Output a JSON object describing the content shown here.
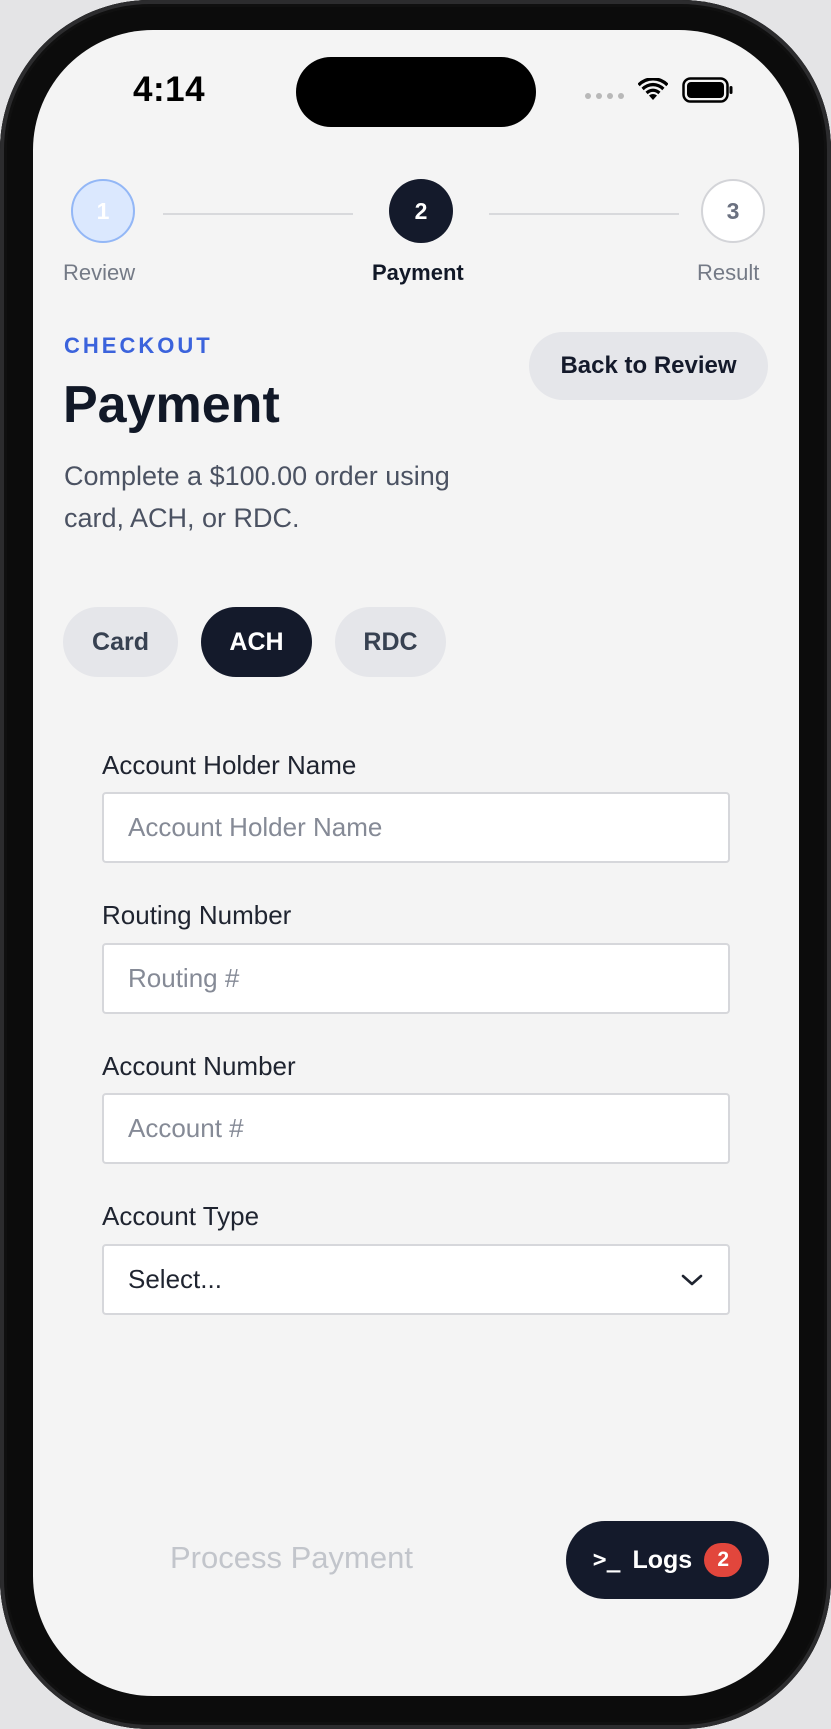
{
  "status_bar": {
    "time": "4:14"
  },
  "stepper": {
    "steps": [
      {
        "number": "1",
        "label": "Review"
      },
      {
        "number": "2",
        "label": "Payment"
      },
      {
        "number": "3",
        "label": "Result"
      }
    ],
    "active_step": 2
  },
  "header": {
    "kicker": "CHECKOUT",
    "title": "Payment",
    "description": "Complete a $100.00 order using card, ACH, or RDC.",
    "back_label": "Back to Review"
  },
  "payment_methods": {
    "options": [
      "Card",
      "ACH",
      "RDC"
    ],
    "selected": "ACH"
  },
  "ach_form": {
    "holder_label": "Account Holder Name",
    "holder_placeholder": "Account Holder Name",
    "routing_label": "Routing Number",
    "routing_placeholder": "Routing #",
    "account_label": "Account Number",
    "account_placeholder": "Account #",
    "type_label": "Account Type",
    "type_value": "Select..."
  },
  "footer": {
    "process_label": "Process Payment",
    "logs_prompt": ">_",
    "logs_label": "Logs",
    "logs_count": "2"
  },
  "colors": {
    "accent": "#3b63dc",
    "primary_dark": "#141a2b",
    "badge": "#e2463c",
    "background": "#f4f4f4"
  }
}
